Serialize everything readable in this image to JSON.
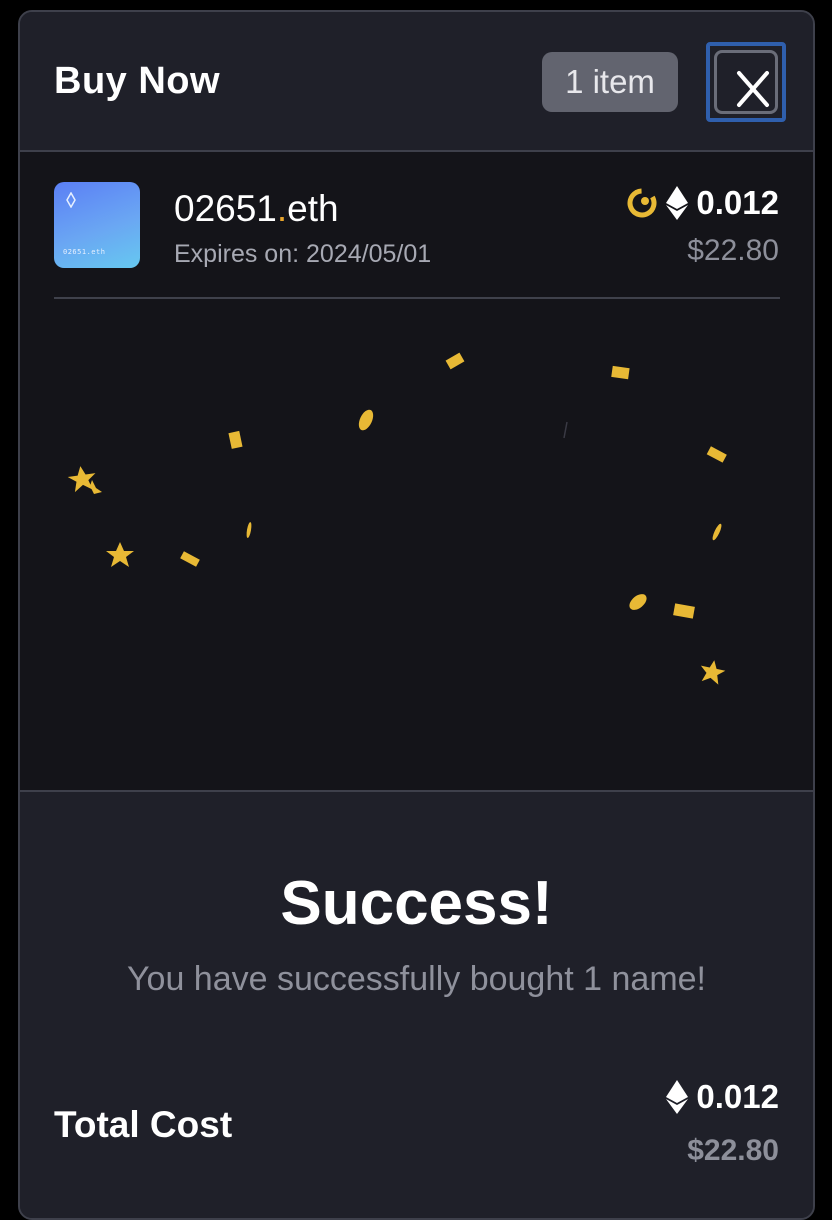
{
  "header": {
    "title": "Buy Now",
    "item_count": "1 item",
    "close_label": "X"
  },
  "item": {
    "name_main": "02651",
    "name_dot": ".",
    "name_tld": "eth",
    "thumb_label": "02651.eth",
    "expires": "Expires on: 2024/05/01",
    "price_eth": "0.012",
    "price_usd": "$22.80",
    "marketplace_icon": "marketplace-ring-icon",
    "currency_icon": "ethereum-icon"
  },
  "success": {
    "title": "Success!",
    "message": "You have successfully bought 1 name!"
  },
  "total": {
    "label": "Total Cost",
    "eth": "0.012",
    "usd": "$22.80"
  },
  "colors": {
    "background": "#1f2029",
    "dark_panel": "#141419",
    "confetti": "#e8b935",
    "accent_orange": "#e8a52c",
    "badge": "#62646f",
    "close_focus": "#2f5fad"
  }
}
